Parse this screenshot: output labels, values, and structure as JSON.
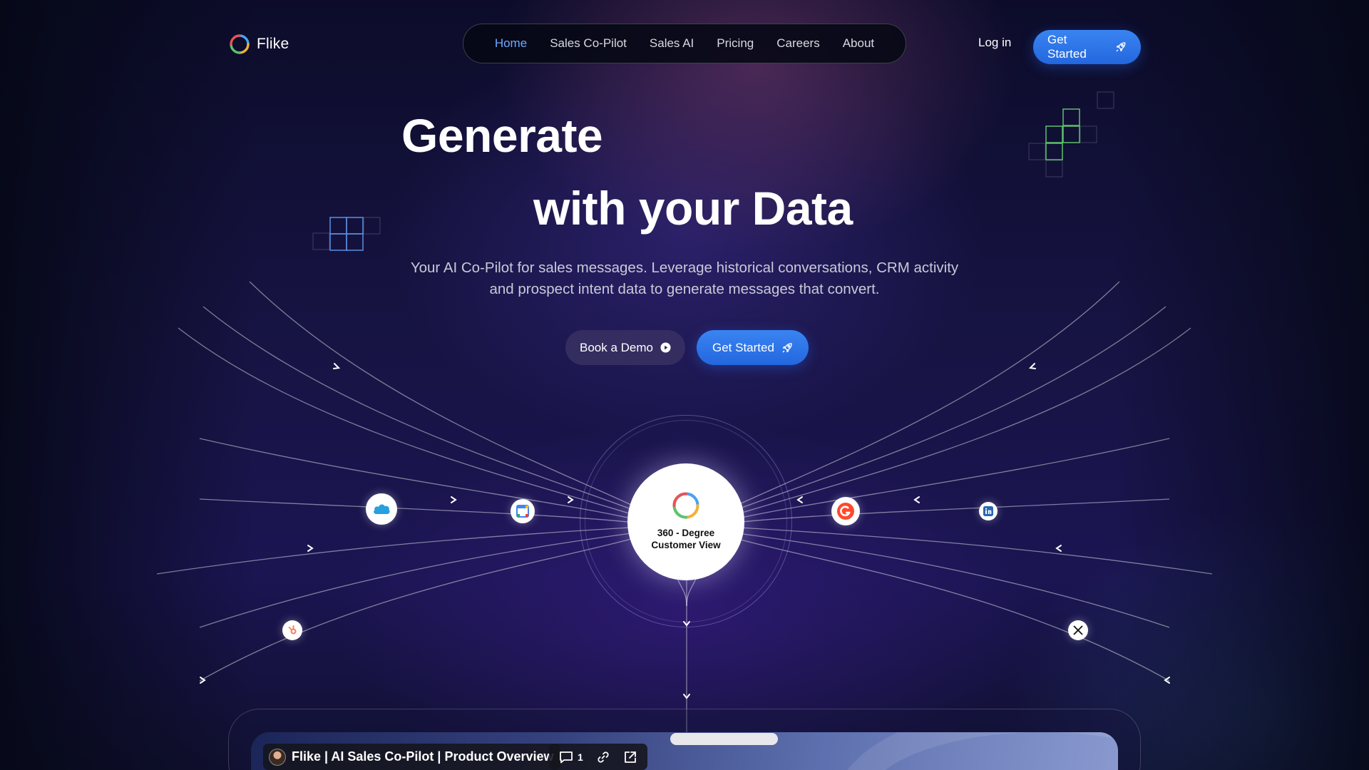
{
  "brand": {
    "name": "Flike"
  },
  "nav": {
    "items": [
      {
        "label": "Home",
        "active": true
      },
      {
        "label": "Sales Co-Pilot"
      },
      {
        "label": "Sales AI"
      },
      {
        "label": "Pricing"
      },
      {
        "label": "Careers"
      },
      {
        "label": "About"
      }
    ]
  },
  "header": {
    "login_label": "Log in",
    "cta_label": "Get Started"
  },
  "hero": {
    "title_line1": "Generate",
    "title_line2": "with your Data",
    "subtitle": "Your AI Co-Pilot for sales messages. Leverage historical conversations, CRM activity and prospect intent data to generate messages that convert.",
    "demo_button": "Book a Demo",
    "cta_button": "Get Started"
  },
  "diagram": {
    "hub_label": "360 - Degree Customer View",
    "sources": [
      "salesforce-icon",
      "google-calendar-icon",
      "hubspot-icon",
      "g2-icon",
      "linkedin-icon",
      "x-icon"
    ]
  },
  "video": {
    "title": "Flike | AI Sales Co-Pilot | Product Overview",
    "comment_count": "1"
  },
  "colors": {
    "accent": "#2f78ea",
    "nav_active": "#6ea8ff",
    "background": "#141240"
  }
}
